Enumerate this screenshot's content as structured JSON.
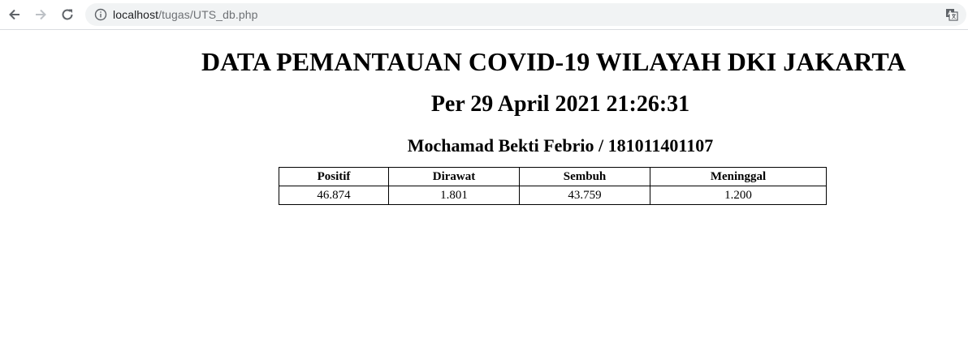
{
  "browser": {
    "url_host": "localhost",
    "url_path": "/tugas/UTS_db.php"
  },
  "page": {
    "title": "DATA PEMANTAUAN COVID-19 WILAYAH DKI JAKARTA",
    "subtitle": "Per 29 April 2021 21:26:31",
    "author": "Mochamad Bekti Febrio / 181011401107"
  },
  "table": {
    "headers": [
      "Positif",
      "Dirawat",
      "Sembuh",
      "Meninggal"
    ],
    "rows": [
      [
        "46.874",
        "1.801",
        "43.759",
        "1.200"
      ]
    ]
  }
}
